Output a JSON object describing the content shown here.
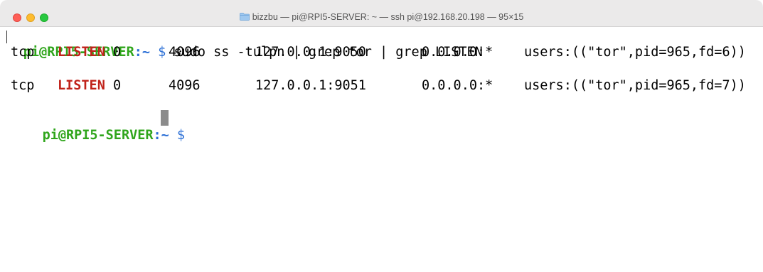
{
  "window": {
    "title": "bizzbu — pi@RPI5-SERVER: ~ — ssh pi@192.168.20.198 — 95×15"
  },
  "prompt": {
    "user_host": "pi@RPI5-SERVER",
    "colon": ":",
    "path": "~",
    "dollar": "$"
  },
  "command": "sudo ss -tulpn | grep tor | grep LISTEN",
  "rows": [
    {
      "netid": "tcp",
      "state": "LISTEN",
      "recvq": "0",
      "sendq": "4096",
      "local": "127.0.0.1:9050",
      "peer": "0.0.0.0:*",
      "process": "users:((\"tor\",pid=965,fd=6))"
    },
    {
      "netid": "tcp",
      "state": "LISTEN",
      "recvq": "0",
      "sendq": "4096",
      "local": "127.0.0.1:9051",
      "peer": "0.0.0.0:*",
      "process": "users:((\"tor\",pid=965,fd=7))"
    }
  ],
  "colors": {
    "prompt_user": "#2fa51b",
    "prompt_path": "#2b6fd6",
    "listen": "#c0221a",
    "cursor": "#8b8b8b"
  }
}
